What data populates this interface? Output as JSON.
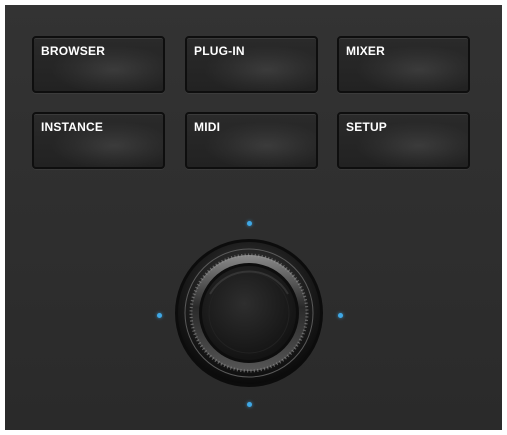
{
  "buttons": {
    "browser": "BROWSER",
    "plugin": "PLUG-IN",
    "mixer": "MIXER",
    "instance": "INSTANCE",
    "midi": "MIDI",
    "setup": "SETUP"
  },
  "encoder": {
    "icon": "push-encoder-knob",
    "led_color": "#3fa8e6",
    "direction_leds": [
      "up",
      "left",
      "right",
      "down"
    ]
  },
  "colors": {
    "panel": "#2f2f2f",
    "button_border": "#0e0e0e",
    "label": "#ffffff"
  }
}
